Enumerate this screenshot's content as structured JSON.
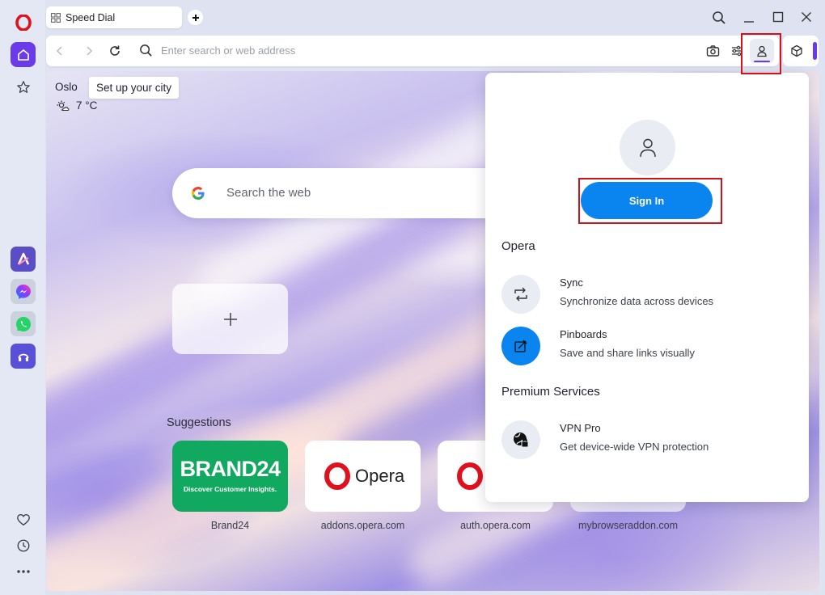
{
  "tab": {
    "title": "Speed Dial"
  },
  "address_bar": {
    "placeholder": "Enter search or web address"
  },
  "weather": {
    "city": "Oslo",
    "setup_tooltip": "Set up your city",
    "temperature": "7 °C"
  },
  "search": {
    "placeholder": "Search the web"
  },
  "suggestions": {
    "title": "Suggestions",
    "items": [
      {
        "label": "Brand24",
        "logo_text": "BRAND24",
        "tagline": "Discover Customer Insights."
      },
      {
        "label": "addons.opera.com",
        "logo_text": "Opera"
      },
      {
        "label": "auth.opera.com"
      },
      {
        "label": "mybrowseraddon.com"
      }
    ]
  },
  "profile_popup": {
    "sign_in_label": "Sign In",
    "section_opera": "Opera",
    "features": [
      {
        "title": "Sync",
        "description": "Synchronize data across devices"
      },
      {
        "title": "Pinboards",
        "description": "Save and share links visually"
      }
    ],
    "section_premium": "Premium Services",
    "premium_features": [
      {
        "title": "VPN Pro",
        "description": "Get device-wide VPN protection"
      }
    ]
  },
  "colors": {
    "accent": "#0a84ef",
    "brand_red": "#e0111c",
    "sidebar_active": "#6b3bea",
    "brand24_green": "#11a85f",
    "highlight_red": "#d0121b"
  },
  "icons": [
    "opera-logo-icon",
    "home-icon",
    "star-icon",
    "aria-icon",
    "messenger-icon",
    "whatsapp-icon",
    "music-player-icon",
    "heart-icon",
    "clock-icon",
    "more-icon",
    "speed-dial-grid-icon",
    "plus-icon",
    "search-icon",
    "minimize-icon",
    "maximize-icon",
    "close-icon",
    "back-icon",
    "forward-icon",
    "reload-icon",
    "camera-icon",
    "easy-setup-icon",
    "profile-icon",
    "cube-icon",
    "sun-cloud-icon",
    "google-icon",
    "sync-icon",
    "pinboards-icon",
    "vpn-icon"
  ]
}
